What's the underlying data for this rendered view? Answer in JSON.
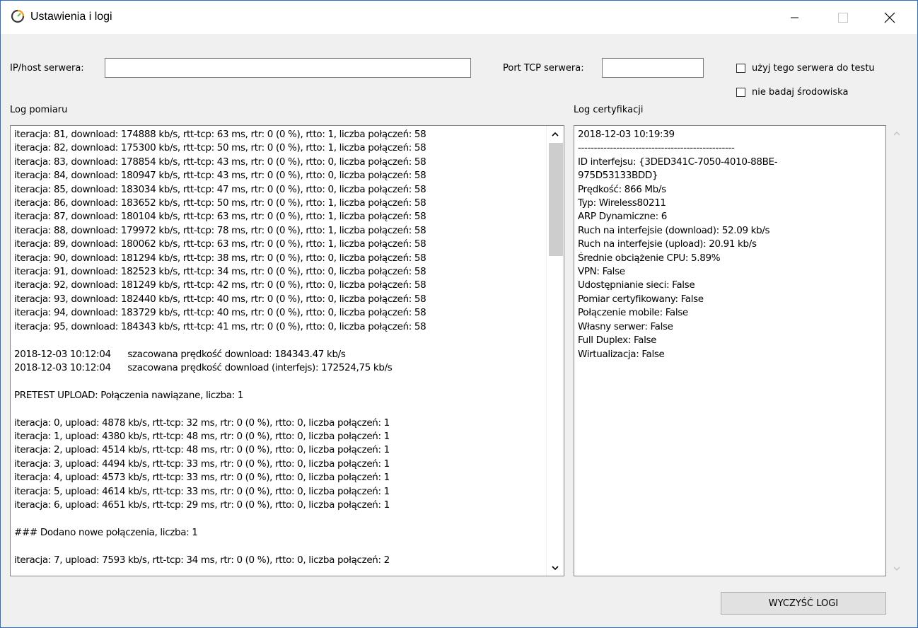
{
  "window": {
    "title": "Ustawienia i logi",
    "icon": "speedometer-icon"
  },
  "server": {
    "ip_label": "IP/host serwera:",
    "ip_value": "",
    "port_label": "Port TCP serwera:",
    "port_value": "",
    "use_server_label": "użyj tego serwera do testu",
    "no_env_label": "nie badaj środowiska"
  },
  "log_measure": {
    "label": "Log pomiaru",
    "lines": [
      "iteracja: 81, download: 174888 kb/s, rtt-tcp: 63 ms, rtr: 0 (0 %), rtto: 1, liczba połączeń: 58",
      "iteracja: 82, download: 175300 kb/s, rtt-tcp: 50 ms, rtr: 0 (0 %), rtto: 1, liczba połączeń: 58",
      "iteracja: 83, download: 178854 kb/s, rtt-tcp: 43 ms, rtr: 0 (0 %), rtto: 0, liczba połączeń: 58",
      "iteracja: 84, download: 180947 kb/s, rtt-tcp: 43 ms, rtr: 0 (0 %), rtto: 0, liczba połączeń: 58",
      "iteracja: 85, download: 183034 kb/s, rtt-tcp: 47 ms, rtr: 0 (0 %), rtto: 0, liczba połączeń: 58",
      "iteracja: 86, download: 183652 kb/s, rtt-tcp: 50 ms, rtr: 0 (0 %), rtto: 1, liczba połączeń: 58",
      "iteracja: 87, download: 180104 kb/s, rtt-tcp: 63 ms, rtr: 0 (0 %), rtto: 1, liczba połączeń: 58",
      "iteracja: 88, download: 179972 kb/s, rtt-tcp: 78 ms, rtr: 0 (0 %), rtto: 1, liczba połączeń: 58",
      "iteracja: 89, download: 180062 kb/s, rtt-tcp: 63 ms, rtr: 0 (0 %), rtto: 1, liczba połączeń: 58",
      "iteracja: 90, download: 181294 kb/s, rtt-tcp: 38 ms, rtr: 0 (0 %), rtto: 0, liczba połączeń: 58",
      "iteracja: 91, download: 182523 kb/s, rtt-tcp: 34 ms, rtr: 0 (0 %), rtto: 0, liczba połączeń: 58",
      "iteracja: 92, download: 181249 kb/s, rtt-tcp: 42 ms, rtr: 0 (0 %), rtto: 0, liczba połączeń: 58",
      "iteracja: 93, download: 182440 kb/s, rtt-tcp: 40 ms, rtr: 0 (0 %), rtto: 0, liczba połączeń: 58",
      "iteracja: 94, download: 183729 kb/s, rtt-tcp: 40 ms, rtr: 0 (0 %), rtto: 0, liczba połączeń: 58",
      "iteracja: 95, download: 184343 kb/s, rtt-tcp: 41 ms, rtr: 0 (0 %), rtto: 0, liczba połączeń: 58",
      "",
      "2018-12-03 10:12:04      szacowana prędkość download: 184343.47 kb/s",
      "2018-12-03 10:12:04      szacowana prędkość download (interfejs): 172524,75 kb/s",
      "",
      "PRETEST UPLOAD: Połączenia nawiązane, liczba: 1",
      "",
      "iteracja: 0, upload: 4878 kb/s, rtt-tcp: 32 ms, rtr: 0 (0 %), rtto: 0, liczba połączeń: 1",
      "iteracja: 1, upload: 4380 kb/s, rtt-tcp: 48 ms, rtr: 0 (0 %), rtto: 0, liczba połączeń: 1",
      "iteracja: 2, upload: 4514 kb/s, rtt-tcp: 48 ms, rtr: 0 (0 %), rtto: 0, liczba połączeń: 1",
      "iteracja: 3, upload: 4494 kb/s, rtt-tcp: 33 ms, rtr: 0 (0 %), rtto: 0, liczba połączeń: 1",
      "iteracja: 4, upload: 4573 kb/s, rtt-tcp: 33 ms, rtr: 0 (0 %), rtto: 0, liczba połączeń: 1",
      "iteracja: 5, upload: 4614 kb/s, rtt-tcp: 33 ms, rtr: 0 (0 %), rtto: 0, liczba połączeń: 1",
      "iteracja: 6, upload: 4651 kb/s, rtt-tcp: 29 ms, rtr: 0 (0 %), rtto: 0, liczba połączeń: 1",
      "",
      "### Dodano nowe połączenia, liczba: 1",
      "",
      "iteracja: 7, upload: 7593 kb/s, rtt-tcp: 34 ms, rtr: 0 (0 %), rtto: 0, liczba połączeń: 2"
    ]
  },
  "log_cert": {
    "label": "Log certyfikacji",
    "lines": [
      "2018-12-03 10:19:39",
      "-------------------------------------------------",
      "ID interfejsu: {3DED341C-7050-4010-88BE-",
      "975D53133BDD}",
      "Prędkość: 866 Mb/s",
      "Typ: Wireless80211",
      "ARP Dynamiczne: 6",
      "Ruch na interfejsie (download): 52.09 kb/s",
      "Ruch na interfejsie (upload): 20.91 kb/s",
      "Średnie obciążenie CPU: 5.89%",
      "VPN: False",
      "Udostępnianie sieci: False",
      "Pomiar certyfikowany: False",
      "Połączenie mobile: False",
      "Własny serwer: False",
      "Full Duplex: False",
      "Wirtualizacja: False"
    ]
  },
  "clear_button": "WYCZYŚĆ LOGI",
  "colors": {
    "window_border": "#2b6cc4",
    "dialog_bg": "#f0f0f0",
    "button_bg": "#e1e1e1",
    "scroll_thumb": "#cdcdcd"
  }
}
